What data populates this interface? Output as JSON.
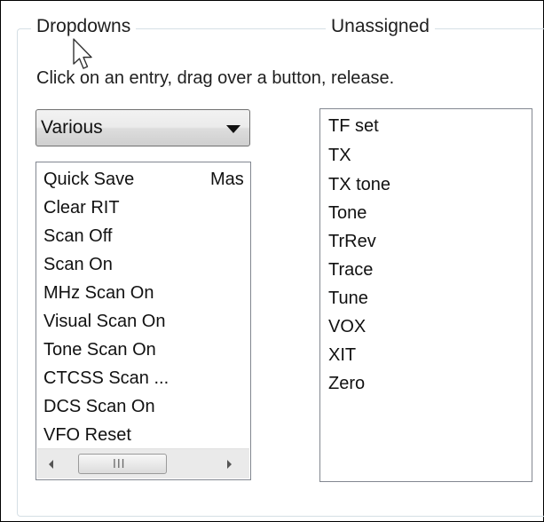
{
  "group": {
    "dropdowns_title": "Dropdowns",
    "unassigned_title": "Unassigned"
  },
  "instruction": "Click on an entry, drag over a button, release.",
  "category_dropdown": {
    "selected": "Various"
  },
  "commands_list": {
    "items": [
      "Quick Save",
      "Clear RIT",
      "Scan Off",
      "Scan On",
      "MHz Scan On",
      "Visual Scan On",
      "Tone Scan On",
      "CTCSS Scan ...",
      "DCS Scan On",
      "VFO Reset"
    ],
    "second_column_partial": "Mas",
    "scrollbar_grip": "III"
  },
  "unassigned_list": {
    "items": [
      "TF set",
      "TX",
      "TX tone",
      "Tone",
      "TrRev",
      "Trace",
      "Tune",
      "VOX",
      "XIT",
      "Zero"
    ]
  }
}
